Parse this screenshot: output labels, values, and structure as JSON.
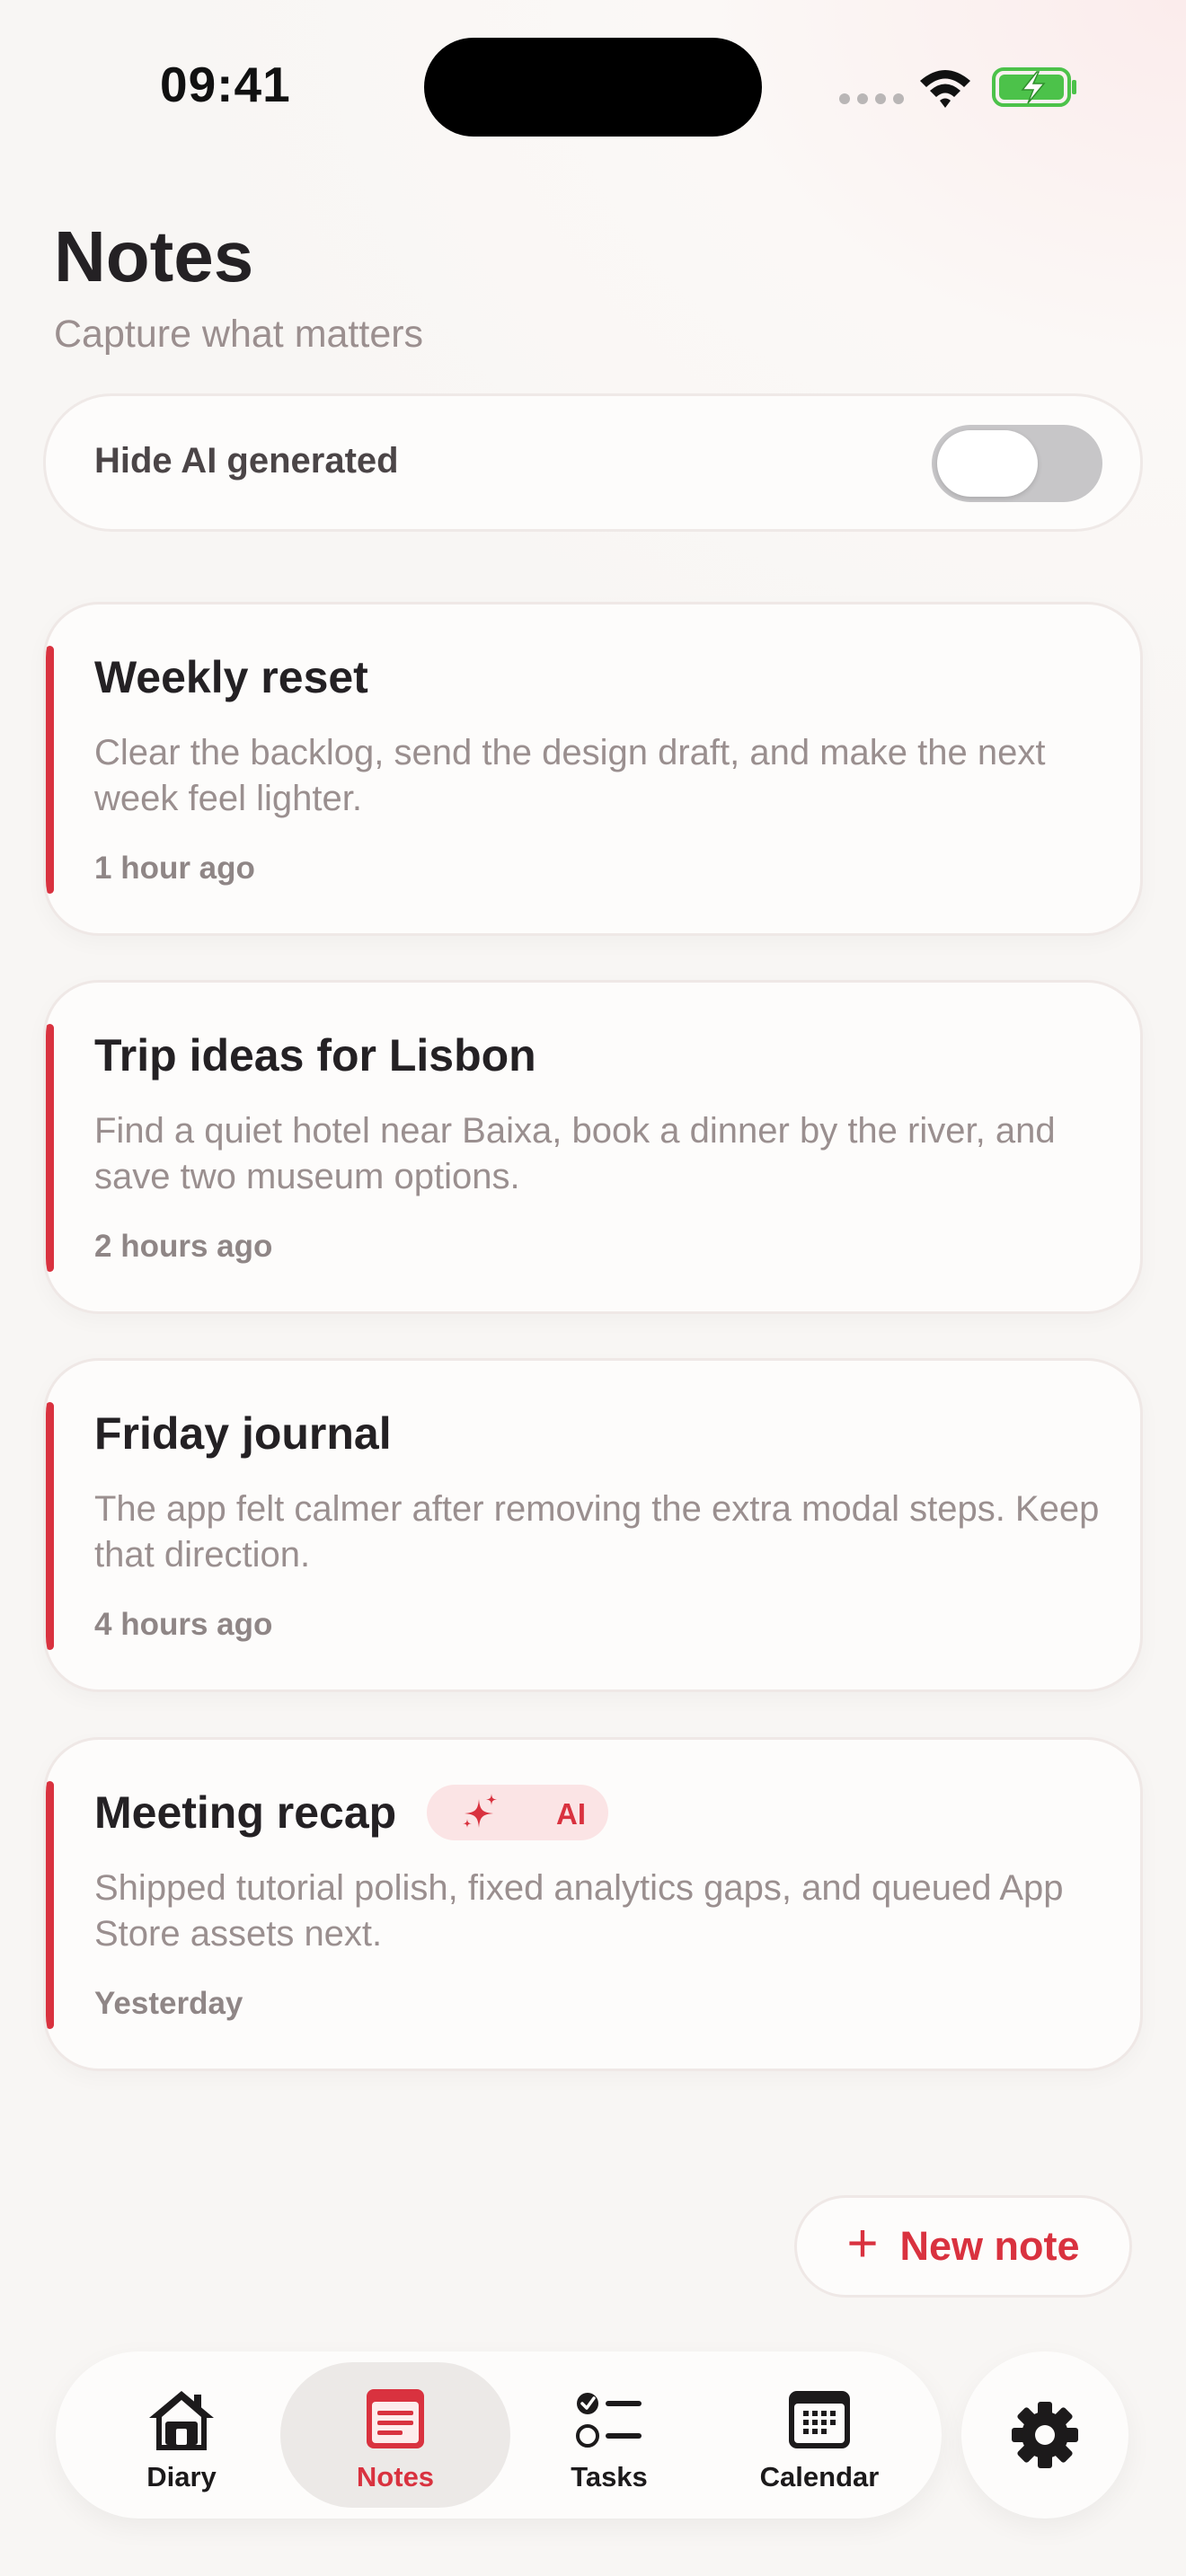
{
  "status_bar": {
    "time": "09:41",
    "icons": [
      "signal-dots-icon",
      "wifi-icon",
      "battery-charging-icon"
    ]
  },
  "header": {
    "title": "Notes",
    "subtitle": "Capture what matters"
  },
  "filter": {
    "label": "Hide AI generated",
    "enabled": false
  },
  "notes": [
    {
      "title": "Weekly reset",
      "body": "Clear the backlog, send the design draft, and make the next week feel lighter.",
      "time": "1 hour ago",
      "ai": false
    },
    {
      "title": "Trip ideas for Lisbon",
      "body": "Find a quiet hotel near Baixa, book a dinner by the river, and save two museum options.",
      "time": "2 hours ago",
      "ai": false
    },
    {
      "title": "Friday journal",
      "body": "The app felt calmer after removing the extra modal steps. Keep that direction.",
      "time": "4 hours ago",
      "ai": false
    },
    {
      "title": "Meeting recap",
      "badge": "AI",
      "body": "Shipped tutorial polish, fixed analytics gaps, and queued App Store assets next.",
      "time": "Yesterday",
      "ai": true
    }
  ],
  "new_note": {
    "plus": "+",
    "label": "New note"
  },
  "tabs": [
    {
      "label": "Diary",
      "icon": "house-icon",
      "active": false
    },
    {
      "label": "Notes",
      "icon": "notes-icon",
      "active": true
    },
    {
      "label": "Tasks",
      "icon": "checklist-icon",
      "active": false
    },
    {
      "label": "Calendar",
      "icon": "calendar-icon",
      "active": false
    }
  ],
  "settings": {
    "icon": "gear-icon"
  },
  "colors": {
    "accent": "#d9323f",
    "background": "#fbf8f6",
    "card": "#fdfcfb",
    "toggle_off": "#c7c6c8",
    "battery_green": "#4cc24a"
  }
}
